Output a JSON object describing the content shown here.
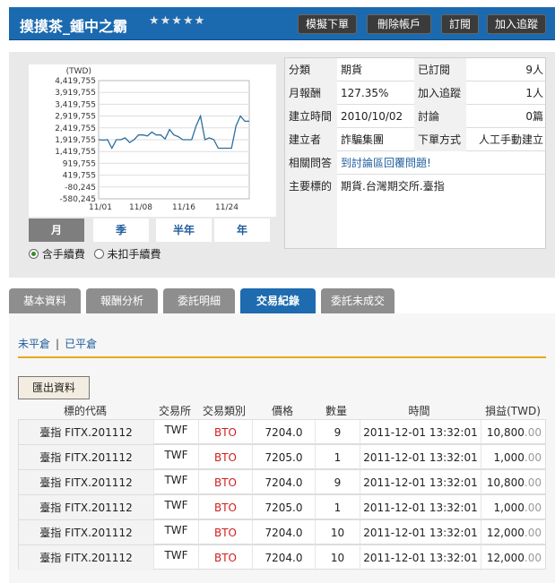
{
  "header": {
    "title": "摸摸茶_鍾中之霸",
    "stars": "★★★★★",
    "buttons": [
      "模擬下單",
      "刪除帳戶",
      "訂閱",
      "加入追蹤"
    ]
  },
  "chart_data": {
    "type": "line",
    "ylabel": "(TWD)",
    "y_ticks": [
      "4,419,755",
      "3,919,755",
      "3,419,755",
      "2,919,755",
      "2,419,755",
      "1,919,755",
      "1,419,755",
      "919,755",
      "419,755",
      "-80,245",
      "-580,245"
    ],
    "x_ticks": [
      "11/01",
      "11/08",
      "11/16",
      "11/24"
    ],
    "ylim": [
      -580245,
      4419755
    ],
    "series": [
      {
        "values": [
          1919755,
          1900000,
          1919755,
          1560000,
          1919755,
          1919755,
          2000000,
          1800000,
          1919755,
          2119755,
          2119755,
          2080000,
          2240000,
          2119755,
          2119755,
          1950000,
          2350000,
          2119755,
          2050000,
          1919755,
          1919755,
          1919755,
          2500000,
          2919755,
          1919755,
          2000000,
          1919755,
          1560000,
          1560000,
          1560000,
          1560000,
          2500000,
          2919755,
          2700000,
          2700000
        ]
      }
    ]
  },
  "periods": [
    "月",
    "季",
    "半年",
    "年"
  ],
  "fee_options": [
    "含手續費",
    "未扣手續費"
  ],
  "info": {
    "category_label": "分類",
    "category": "期貨",
    "subscribed_label": "已訂閱",
    "subscribed": "9人",
    "monthly_return_label": "月報酬",
    "monthly_return": "127.35%",
    "followers_label": "加入追蹤",
    "followers": "1人",
    "created_label": "建立時間",
    "created": "2010/10/02",
    "discussion_label": "討論",
    "discussion": "0篇",
    "creator_label": "建立者",
    "creator": "詐騙集團",
    "order_method_label": "下單方式",
    "order_method": "人工手動建立",
    "faq_label": "相關問答",
    "faq_link": "到討論區回覆問題!",
    "main_target_label": "主要標的",
    "main_target": "期貨.台灣期交所.臺指"
  },
  "tabs": [
    "基本資料",
    "報酬分析",
    "委託明細",
    "交易紀錄",
    "委託未成交"
  ],
  "subnav": [
    "未平倉",
    "已平倉"
  ],
  "export_label": "匯出資料",
  "columns": [
    "標的代碼",
    "交易所",
    "交易類別",
    "價格",
    "數量",
    "時間",
    "損益(TWD)"
  ],
  "rows": [
    {
      "code": "臺指 FITX.201112",
      "exchange": "TWF",
      "type": "BTO",
      "price": "7204.0",
      "qty": "9",
      "time": "2011-12-01 13:32:01",
      "pnl_main": "10,800",
      "pnl_dec": ".00"
    },
    {
      "code": "臺指 FITX.201112",
      "exchange": "TWF",
      "type": "BTO",
      "price": "7205.0",
      "qty": "1",
      "time": "2011-12-01 13:32:01",
      "pnl_main": "1,000",
      "pnl_dec": ".00"
    },
    {
      "code": "臺指 FITX.201112",
      "exchange": "TWF",
      "type": "BTO",
      "price": "7204.0",
      "qty": "9",
      "time": "2011-12-01 13:32:01",
      "pnl_main": "10,800",
      "pnl_dec": ".00"
    },
    {
      "code": "臺指 FITX.201112",
      "exchange": "TWF",
      "type": "BTO",
      "price": "7205.0",
      "qty": "1",
      "time": "2011-12-01 13:32:01",
      "pnl_main": "1,000",
      "pnl_dec": ".00"
    },
    {
      "code": "臺指 FITX.201112",
      "exchange": "TWF",
      "type": "BTO",
      "price": "7204.0",
      "qty": "10",
      "time": "2011-12-01 13:32:01",
      "pnl_main": "12,000",
      "pnl_dec": ".00"
    },
    {
      "code": "臺指 FITX.201112",
      "exchange": "TWF",
      "type": "BTO",
      "price": "7204.0",
      "qty": "10",
      "time": "2011-12-01 13:32:01",
      "pnl_main": "12,000",
      "pnl_dec": ".00"
    }
  ]
}
